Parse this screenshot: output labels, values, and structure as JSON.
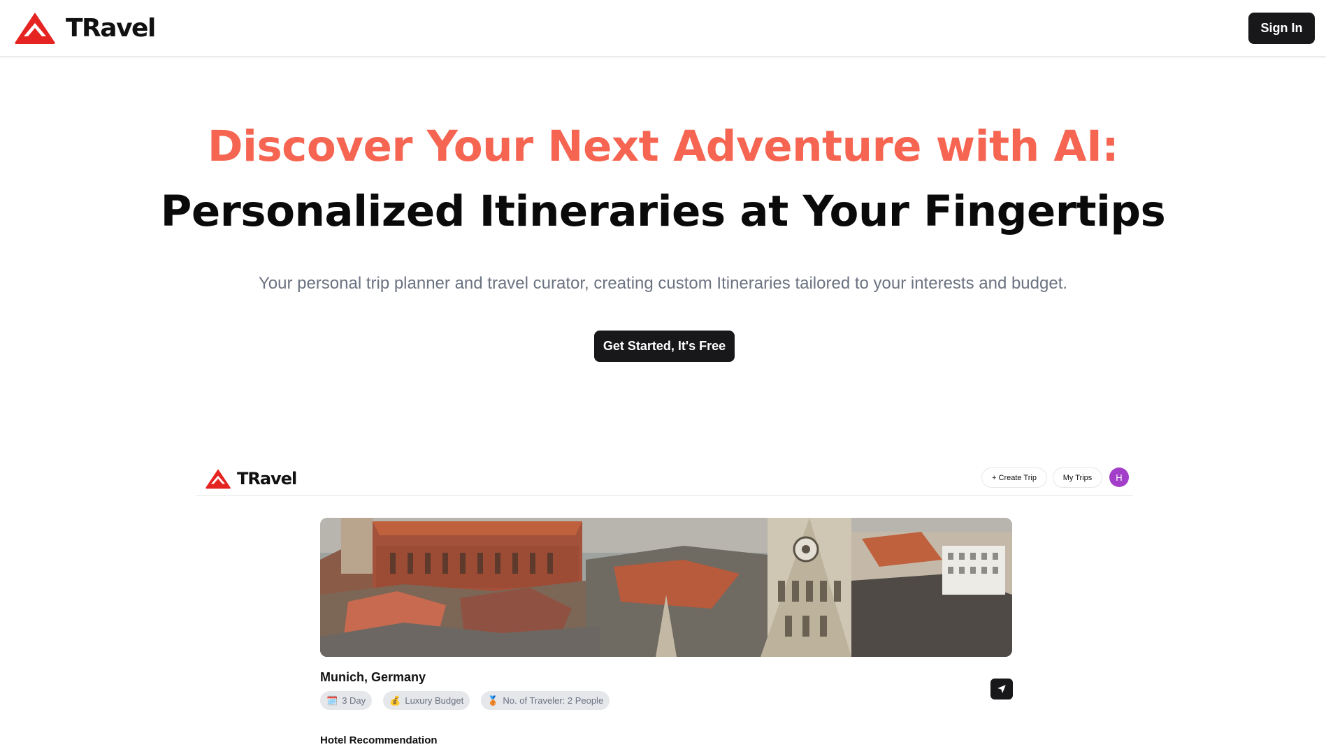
{
  "brand": {
    "name": "TRavel",
    "color": "#e52320"
  },
  "header": {
    "signin_label": "Sign In"
  },
  "hero": {
    "title_line1": "Discover Your Next Adventure with AI:",
    "title_line2": "Personalized Itineraries at Your Fingertips",
    "subtitle": "Your personal trip planner and travel curator, creating custom Itineraries tailored to your interests and budget.",
    "cta_label": "Get Started, It's Free",
    "accent_color": "#f56551"
  },
  "preview": {
    "brand": "TRavel",
    "create_trip_label": "+ Create Trip",
    "my_trips_label": "My Trips",
    "avatar_initial": "H",
    "trip": {
      "location": "Munich, Germany",
      "chips": [
        {
          "icon": "calendar-icon",
          "emoji": "🗓️",
          "label": "3 Day"
        },
        {
          "icon": "money-bag-icon",
          "emoji": "💰",
          "label": "Luxury Budget"
        },
        {
          "icon": "medal-icon",
          "emoji": "🥉",
          "label": "No. of Traveler: 2 People"
        }
      ]
    },
    "section_heading": "Hotel Recommendation"
  }
}
